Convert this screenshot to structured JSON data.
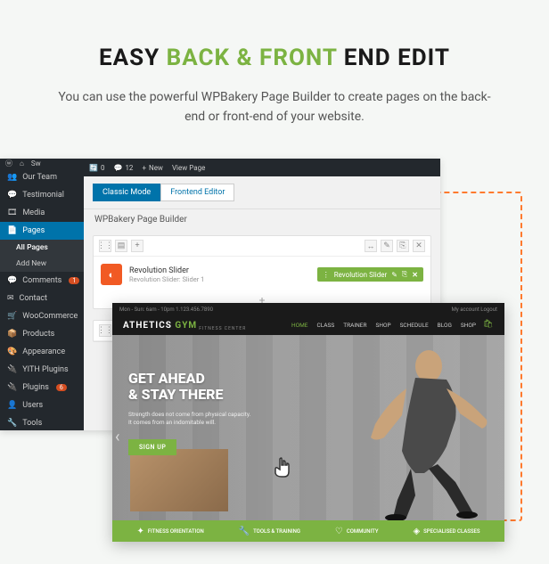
{
  "title": {
    "easy": "EASY",
    "backfront": "BACK & FRONT",
    "endedit": "END EDIT"
  },
  "subtitle": "You can use the powerful WPBakery Page Builder to create pages on the back-end or front-end of your website.",
  "wp_bar": {
    "new": "New",
    "view": "View Page",
    "sw": "Sw",
    "comments": "12",
    "updates": "0",
    "plugins": "6"
  },
  "sidebar": [
    {
      "icon": "👥",
      "label": "Our Team"
    },
    {
      "icon": "💬",
      "label": "Testimonial"
    },
    {
      "icon": "🎞",
      "label": "Media"
    },
    {
      "icon": "📄",
      "label": "Pages",
      "active": true
    },
    {
      "sub": true,
      "label": "All Pages",
      "subactive": true
    },
    {
      "sub": true,
      "label": "Add New"
    },
    {
      "icon": "💬",
      "label": "Comments",
      "badge": "1"
    },
    {
      "icon": "✉",
      "label": "Contact"
    },
    {
      "icon": "🛒",
      "label": "WooCommerce"
    },
    {
      "icon": "📦",
      "label": "Products"
    },
    {
      "icon": "🎨",
      "label": "Appearance"
    },
    {
      "icon": "🔌",
      "label": "YITH Plugins"
    },
    {
      "icon": "🔌",
      "label": "Plugins",
      "badge": "6"
    },
    {
      "icon": "👤",
      "label": "Users"
    },
    {
      "icon": "🔧",
      "label": "Tools"
    }
  ],
  "mode": {
    "classic": "Classic Mode",
    "frontend": "Frontend Editor"
  },
  "wpb": {
    "title": "WPBakery Page Builder",
    "rs_title": "Revolution Slider",
    "rs_sub": "Revolution Slider: Slider 1",
    "rs_pill": "Revolution Slider"
  },
  "fe": {
    "topbar_left": "Mon - Sun: 6am - 10pm    1.123.456.7890",
    "topbar_right": "My account    Logout",
    "logo_a": "ATHETICS",
    "logo_b": "GYM",
    "logo_tag": "FITNESS CENTER",
    "nav": [
      "HOME",
      "CLASS",
      "TRAINER",
      "SHOP",
      "SCHEDULE",
      "BLOG",
      "SHOP"
    ],
    "hero_l1": "GET AHEAD",
    "hero_l2": "& STAY THERE",
    "hero_sub1": "Strength does not come from physical capacity.",
    "hero_sub2": "It comes from an indomitable will.",
    "cta": "SIGN UP",
    "features": [
      {
        "icon": "✦",
        "label": "FITNESS ORIENTATION"
      },
      {
        "icon": "🔧",
        "label": "TOOLS & TRAINING"
      },
      {
        "icon": "♡",
        "label": "COMMUNITY"
      },
      {
        "icon": "◈",
        "label": "SPECIALISED CLASSES"
      }
    ]
  }
}
